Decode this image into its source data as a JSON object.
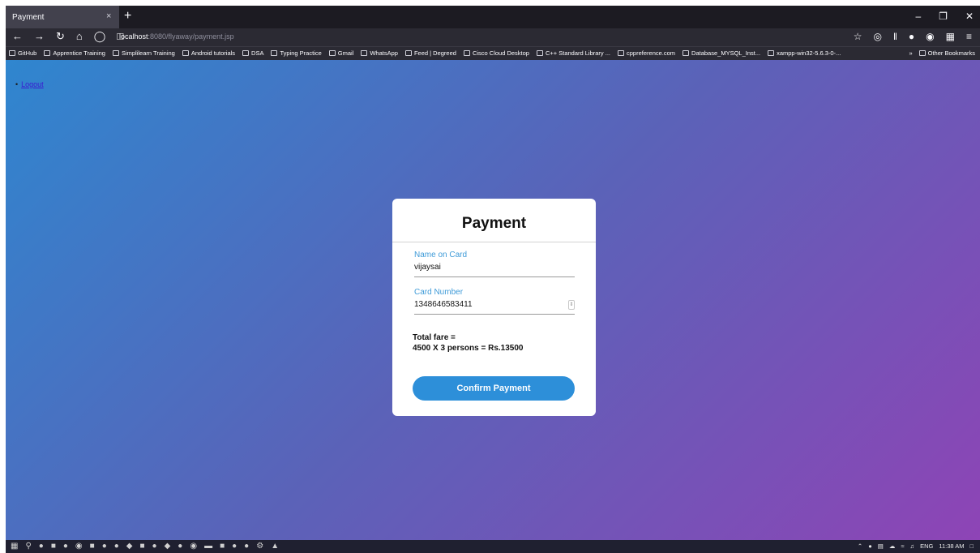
{
  "browser": {
    "tab_title": "Payment",
    "tab_close": "×",
    "new_tab": "+",
    "url_host": "localhost",
    "url_rest": ":8080/flyaway/payment.jsp",
    "bookmarks": [
      "GitHub",
      "Apprentice Training",
      "Simplilearn Training",
      "Android tutorials",
      "DSA",
      "Typing Practice",
      "Gmail",
      "WhatsApp",
      "Feed | Degreed",
      "Cisco Cloud Desktop",
      "C++ Standard Library ...",
      "cppreference.com",
      "Database_MYSQL_Inst...",
      "xampp-win32-5.6.3-0-..."
    ],
    "bookmarks_overflow": "»",
    "other_bookmarks": "Other Bookmarks"
  },
  "page": {
    "logout": "Logout",
    "card": {
      "title": "Payment",
      "name_label": "Name on Card",
      "name_value": "vijaysai",
      "card_label": "Card Number",
      "card_value": "1348646583411",
      "fare_line1": "Total fare =",
      "fare_line2": "4500 X 3 persons = Rs.13500",
      "confirm_label": "Confirm Payment"
    }
  },
  "taskbar": {
    "lang": "ENG",
    "time": "11:38 AM"
  },
  "colors": {
    "gradient_start": "#2f86cf",
    "gradient_end": "#8e44b6",
    "accent": "#2d8fd9",
    "label": "#3f9bd8"
  }
}
